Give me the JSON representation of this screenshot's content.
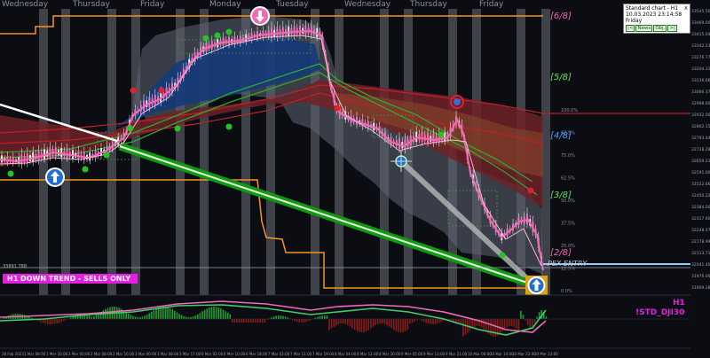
{
  "colors": {
    "background": "#0b0d13",
    "orange_level": "#f7931e",
    "trend_banner": "#e51ee5",
    "green_trendline": "#119911",
    "candle_pink": "#f06ab5",
    "blue_cloud": "#143a7a",
    "red_cloud": "#6e2228",
    "grey_band": "#5e6673"
  },
  "days": [
    "Wednesday",
    "Thursday",
    "Friday",
    "Monday",
    "Tuesday",
    "Wednesday",
    "Thursday",
    "Friday"
  ],
  "murrey": {
    "l6": "[6/8]",
    "l5": "[5/8]",
    "l4": "[4/8]",
    "l3": "[3/8]",
    "l2": "[2/8]"
  },
  "info_panel": {
    "title": "Standard chart - H1",
    "datetime": "10.03.2023    23:14:58",
    "day": "Friday",
    "btn_prev": "|<",
    "btn_news": "News",
    "btn_obj": "Obj.",
    "btn_next": ">|",
    "close": "x"
  },
  "trend_banner": "H1  DOWN TREND - SELLS ONLY",
  "entry_label": "PEX  ENTRY",
  "small_price": "33891.788",
  "subwindow": {
    "timeframe": "H1",
    "symbol": "!STD_DJI30"
  },
  "price_axis": [
    "33545.505",
    "33469.000",
    "33415.040",
    "33342.230",
    "33276.770",
    "33204.315",
    "33136.660",
    "33066.375",
    "32998.605",
    "32932.000",
    "32862.155",
    "32793.440",
    "32728.280",
    "32659.210",
    "32591.000",
    "32522.665",
    "32450.220",
    "32384.000",
    "32317.605",
    "32248.470",
    "32178.990",
    "32113.710",
    "32041.405",
    "31976.000",
    "31909.280"
  ],
  "percent_levels": [
    "100.0%",
    "87.5%",
    "75.0%",
    "62.5%",
    "50.0%",
    "37.5%",
    "25.0%",
    "12.5%",
    "0.0%"
  ],
  "time_axis": [
    "28 Feb 2023",
    "1 Mar 08:00",
    "1 Mar 16:00",
    "2 Mar 00:00",
    "2 Mar 08:00",
    "2 Mar 16:00",
    "3 Mar 00:00",
    "3 Mar 08:00",
    "3 Mar 17:00",
    "6 Mar 02:00",
    "6 Mar 10:00",
    "6 Mar 18:00",
    "7 Mar 03:00",
    "7 Mar 11:00",
    "7 Mar 19:00",
    "8 Mar 04:00",
    "8 Mar 12:00",
    "8 Mar 20:00",
    "9 Mar 05:00",
    "9 Mar 13:00",
    "9 Mar 21:00",
    "10 Mar 06:00",
    "10 Mar 14:00",
    "10 Mar 22:00",
    "10 Mar 23:00"
  ]
}
